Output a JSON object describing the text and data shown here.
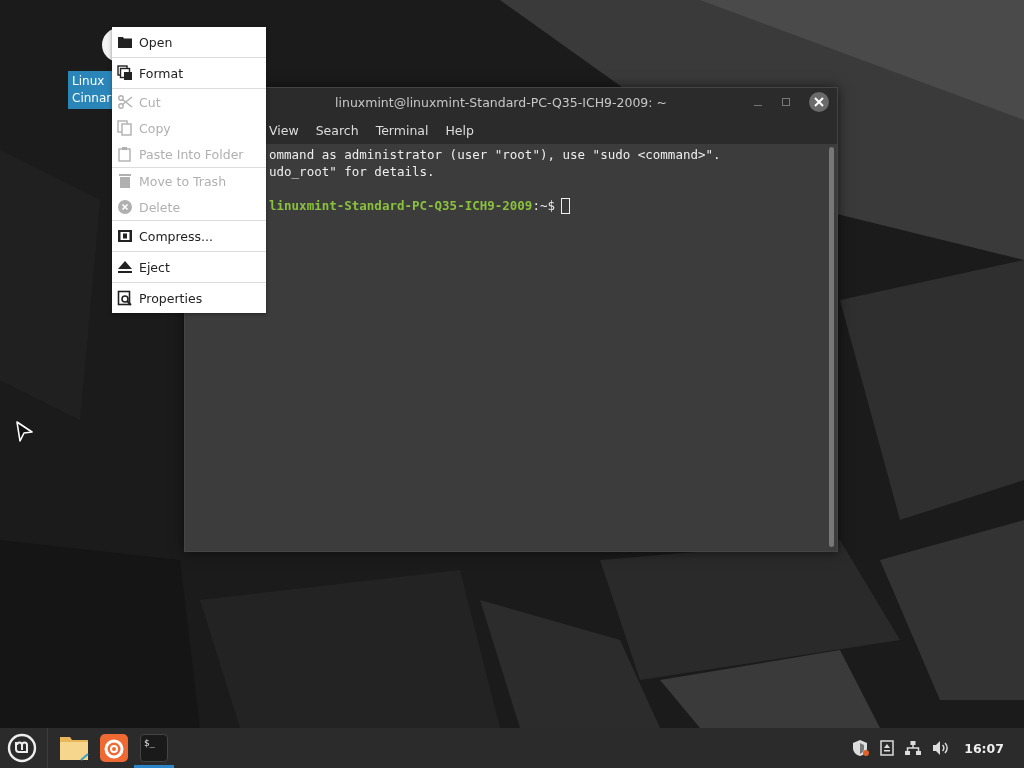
{
  "desktop_icon": {
    "label_lines": [
      "Linux",
      "Cinnar"
    ],
    "selected": true
  },
  "terminal": {
    "title": "linuxmint@linuxmint-Standard-PC-Q35-ICH9-2009: ~",
    "menu": [
      "View",
      "Search",
      "Terminal",
      "Help"
    ],
    "lines": [
      "ommand as administrator (user \"root\"), use \"sudo <command>\".",
      "udo_root\" for details."
    ],
    "prompt": {
      "host": "linuxmint-Standard-PC-Q35-ICH9-2009",
      "path": ":~$"
    }
  },
  "context_menu": [
    [
      {
        "label": "Open",
        "disabled": false
      }
    ],
    [
      {
        "label": "Format",
        "disabled": false
      }
    ],
    [
      {
        "label": "Cut",
        "disabled": true
      },
      {
        "label": "Copy",
        "disabled": true
      },
      {
        "label": "Paste Into Folder",
        "disabled": true
      }
    ],
    [
      {
        "label": "Move to Trash",
        "disabled": true
      },
      {
        "label": "Delete",
        "disabled": true
      }
    ],
    [
      {
        "label": "Compress...",
        "disabled": false
      }
    ],
    [
      {
        "label": "Eject",
        "disabled": false
      }
    ],
    [
      {
        "label": "Properties",
        "disabled": false
      }
    ]
  ],
  "taskbar": {
    "apps": [
      {
        "kind": "files",
        "selected": false
      },
      {
        "kind": "browser",
        "selected": false
      },
      {
        "kind": "terminal",
        "selected": true,
        "label": "$_"
      }
    ],
    "clock": "16:07"
  }
}
